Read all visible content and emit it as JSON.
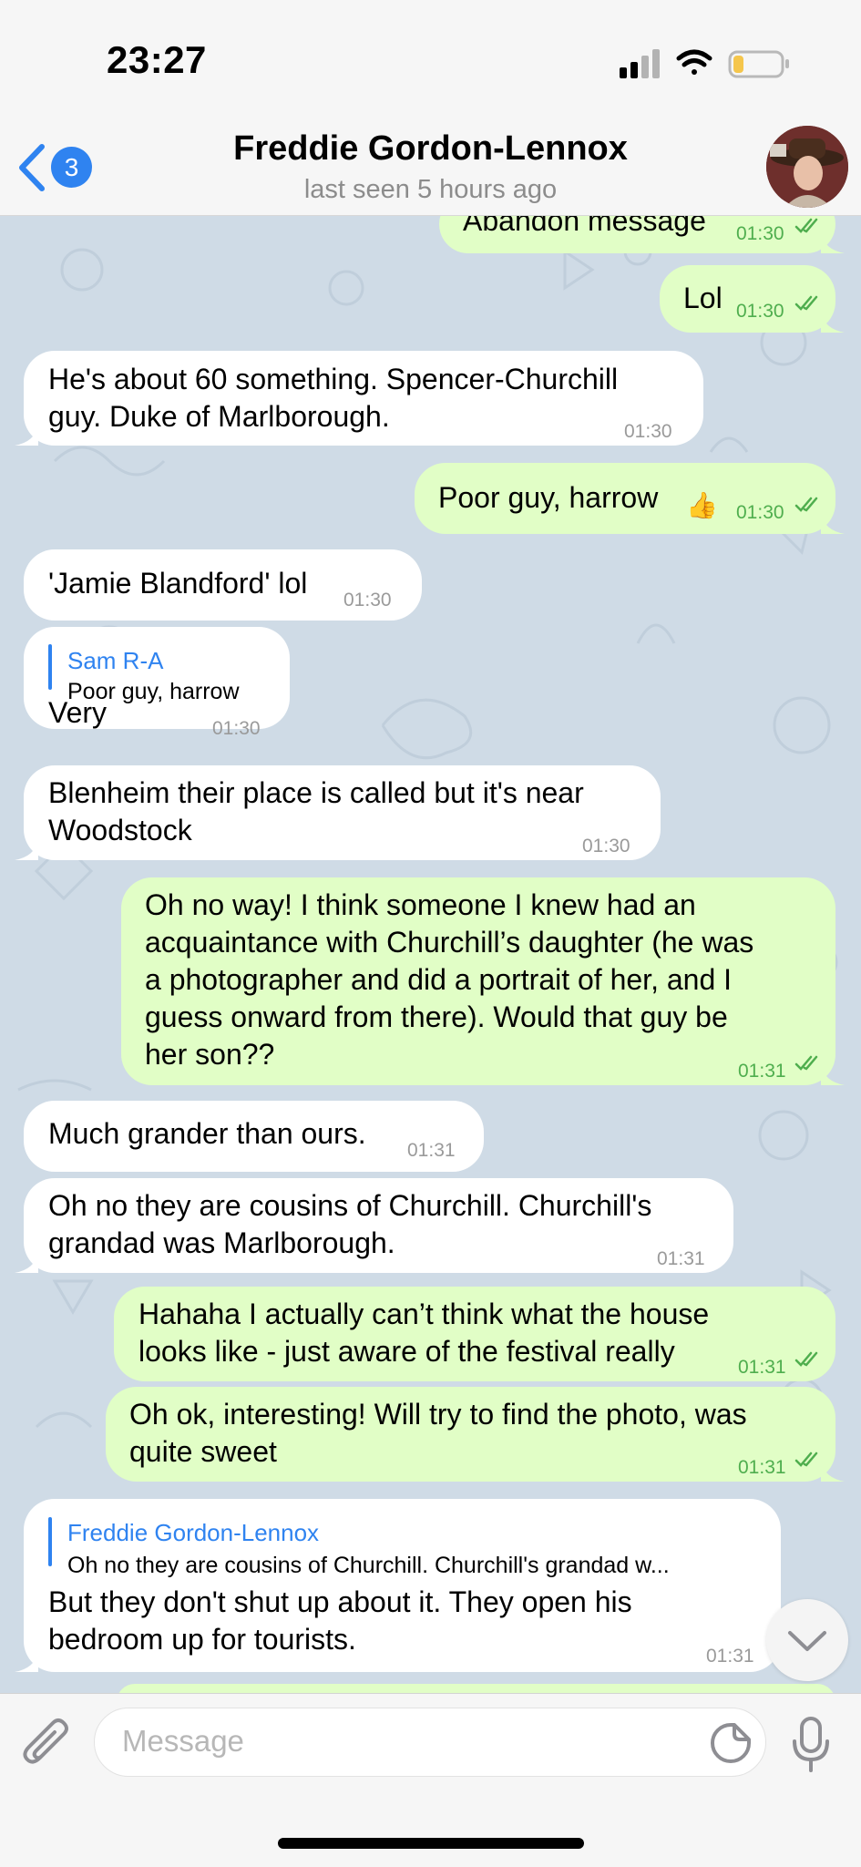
{
  "status": {
    "time": "23:27"
  },
  "header": {
    "back_count": "3",
    "title": "Freddie Gordon-Lennox",
    "subtitle": "last seen 5 hours ago"
  },
  "messages": [
    {
      "dir": "out",
      "text": "Abandon message",
      "time": "01:30"
    },
    {
      "dir": "out",
      "text": "Lol",
      "time": "01:30"
    },
    {
      "dir": "in",
      "lines": [
        "He's about 60 something. Spencer-Churchill",
        "guy. Duke of Marlborough."
      ],
      "time": "01:30"
    },
    {
      "dir": "out",
      "text": "Poor guy, harrow",
      "emoji": "👍",
      "time": "01:30"
    },
    {
      "dir": "in",
      "text": "'Jamie Blandford' lol",
      "time": "01:30"
    },
    {
      "dir": "in",
      "reply_name": "Sam R-A",
      "reply_text": "Poor guy, harrow",
      "text": "Very",
      "time": "01:30"
    },
    {
      "dir": "in",
      "lines": [
        "Blenheim their place is called but it's near",
        "Woodstock"
      ],
      "time": "01:30"
    },
    {
      "dir": "out",
      "lines": [
        "Oh no way! I think someone I knew had an",
        "acquaintance with Churchill’s daughter (he was",
        "a photographer and did a portrait of her, and I",
        "guess onward from there). Would that guy be",
        "her son??"
      ],
      "time": "01:31"
    },
    {
      "dir": "in",
      "text": "Much grander than ours.",
      "time": "01:31"
    },
    {
      "dir": "in",
      "lines": [
        "Oh no they are cousins of Churchill. Churchill's",
        "grandad was Marlborough."
      ],
      "time": "01:31"
    },
    {
      "dir": "out",
      "lines": [
        "Hahaha I actually can’t think what the house",
        "looks like - just aware of the festival really"
      ],
      "time": "01:31"
    },
    {
      "dir": "out",
      "lines": [
        "Oh ok, interesting! Will try to find the photo, was",
        "quite sweet"
      ],
      "time": "01:31"
    },
    {
      "dir": "in",
      "reply_name": "Freddie Gordon-Lennox",
      "reply_text": "Oh no they are cousins of Churchill. Churchill's grandad w...",
      "lines": [
        "But they don't shut up about it. They open his",
        "bedroom up for tourists."
      ],
      "time": "01:31"
    }
  ],
  "input": {
    "placeholder": "Message"
  },
  "icons": [
    "signal-icon",
    "wifi-icon",
    "battery-icon",
    "back-chevron-icon",
    "attach-icon",
    "sticker-icon",
    "mic-icon",
    "chevron-down-icon",
    "double-check-icon"
  ],
  "colors": {
    "accent": "#2f83f0",
    "outgoing_bubble": "#e1fec6",
    "incoming_bubble": "#ffffff",
    "read_check": "#4fae4e",
    "chat_background": "#cfdbe6"
  }
}
